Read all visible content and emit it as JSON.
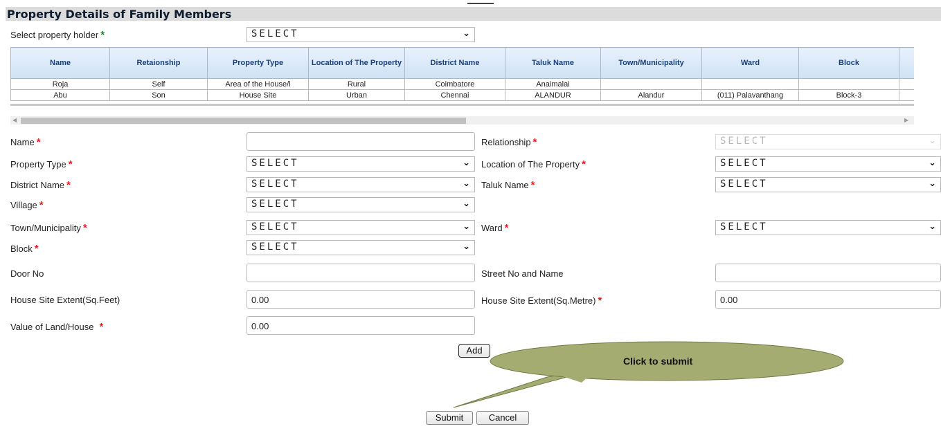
{
  "section_title": "Property Details of Family Members",
  "holder": {
    "label": "Select property holder",
    "value": "SELECT"
  },
  "table": {
    "headers": [
      "Name",
      "Retaionship",
      "Property Type",
      "Location of The Property",
      "District Name",
      "Taluk Name",
      "Town/Municipality",
      "Ward",
      "Block"
    ],
    "rows": [
      [
        "Roja",
        "Self",
        "Area of the House/l",
        "Rural",
        "Coimbatore",
        "Anaimalai",
        "",
        "",
        ""
      ],
      [
        "Abu",
        "Son",
        "House Site",
        "Urban",
        "Chennai",
        "ALANDUR",
        "Alandur",
        "(011) Palavanthang",
        "Block-3"
      ]
    ]
  },
  "form": {
    "name_label": "Name",
    "relationship_label": "Relationship",
    "relationship_value": "SELECT",
    "property_type_label": "Property Type",
    "property_type_value": "SELECT",
    "location_label": "Location of The Property",
    "location_value": "SELECT",
    "district_label": "District Name",
    "district_value": "SELECT",
    "taluk_label": "Taluk Name",
    "taluk_value": "SELECT",
    "village_label": "Village",
    "village_value": "SELECT",
    "town_label": "Town/Municipality",
    "town_value": "SELECT",
    "ward_label": "Ward",
    "ward_value": "SELECT",
    "block_label": "Block",
    "block_value": "SELECT",
    "door_label": "Door No",
    "street_label": "Street No and Name",
    "sqfeet_label": "House Site Extent(Sq.Feet)",
    "sqfeet_value": "0.00",
    "sqmetre_label": "House Site Extent(Sq.Metre)",
    "sqmetre_value": "0.00",
    "value_label": "Value of Land/House",
    "value_value": "0.00"
  },
  "buttons": {
    "add": "Add",
    "submit": "Submit",
    "cancel": "Cancel"
  },
  "callout": {
    "text": "Click to submit",
    "fill": "#a4ac72"
  },
  "colors": {
    "required": "#e02020",
    "required_holder": "#1a8a1a",
    "header_bg": "#dcdcdc",
    "title": "#0d1b2e"
  }
}
